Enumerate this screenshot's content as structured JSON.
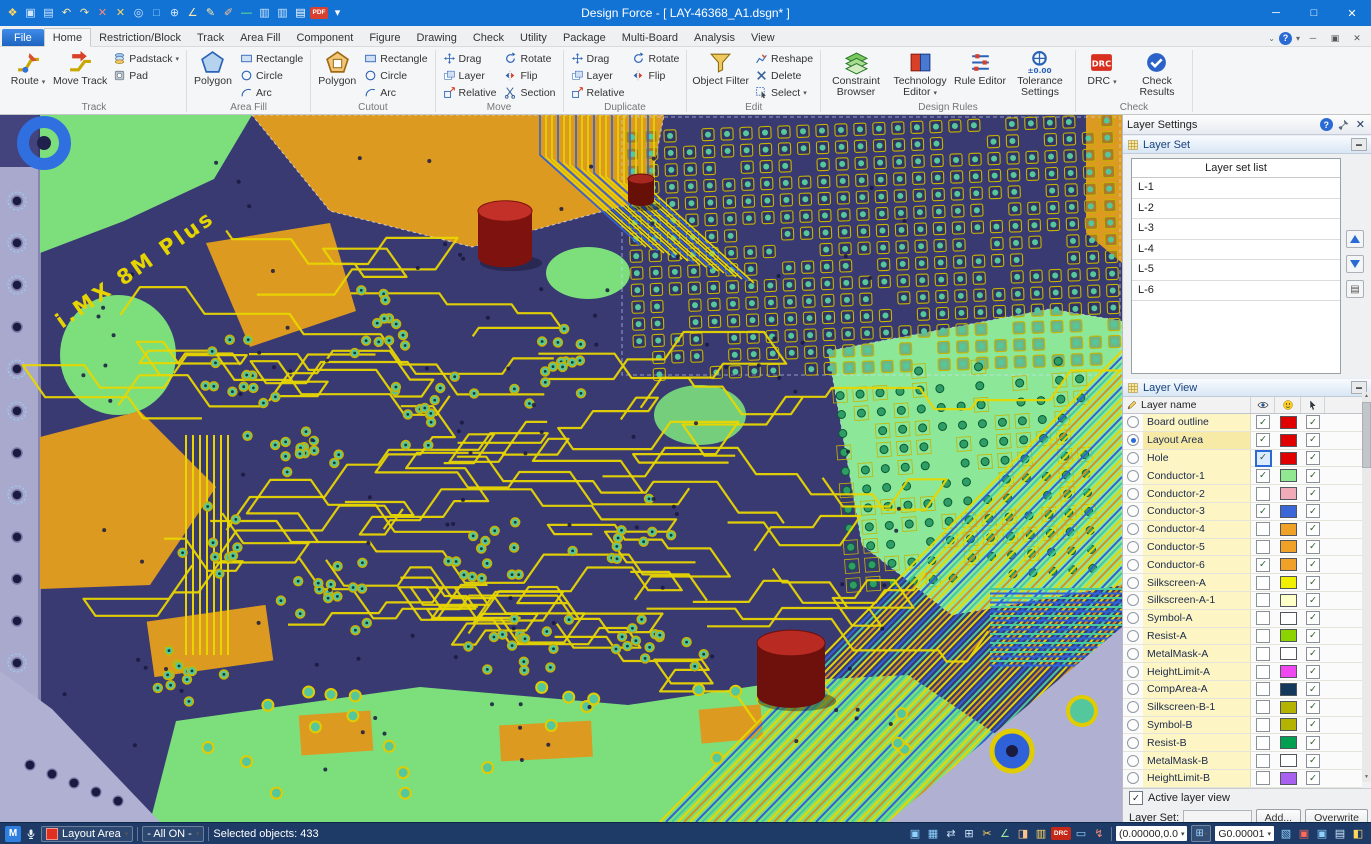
{
  "window": {
    "title": "Design Force - [ LAY-46368_A1.dsgn* ]"
  },
  "qat_icons": [
    {
      "name": "app-logo-icon",
      "glyph": "❖",
      "color": "#ffd65e"
    },
    {
      "name": "save-icon",
      "glyph": "▣",
      "color": "#cfe6ff"
    },
    {
      "name": "print-icon",
      "glyph": "▤",
      "color": "#cfe6ff"
    },
    {
      "name": "undo-icon",
      "glyph": "↶",
      "color": "#ffe9a8"
    },
    {
      "name": "redo-icon",
      "glyph": "↷",
      "color": "#ffe9a8"
    },
    {
      "name": "delete-red-icon",
      "glyph": "✕",
      "color": "#ff8a76"
    },
    {
      "name": "delete-yellow-icon",
      "glyph": "✕",
      "color": "#ffd65e"
    },
    {
      "name": "zoom-window-icon",
      "glyph": "◎",
      "color": "#cfe6ff"
    },
    {
      "name": "select-mode-icon",
      "glyph": "□",
      "color": "#9fd4ff"
    },
    {
      "name": "pan-icon",
      "glyph": "⊕",
      "color": "#cfe6ff"
    },
    {
      "name": "angle-measure-icon",
      "glyph": "∠",
      "color": "#ffe9a8"
    },
    {
      "name": "pencil-icon",
      "glyph": "✎",
      "color": "#ffe9a8"
    },
    {
      "name": "highlight-icon",
      "glyph": "✐",
      "color": "#ffc08a"
    },
    {
      "name": "line-style-icon",
      "glyph": "—",
      "color": "#7aff7a"
    },
    {
      "name": "window-tile-icon",
      "glyph": "▥",
      "color": "#cfe6ff"
    },
    {
      "name": "window-cascade-icon",
      "glyph": "▥",
      "color": "#cfe6ff"
    },
    {
      "name": "report-icon",
      "glyph": "▤",
      "color": "#ffffff"
    },
    {
      "name": "pdf-export-icon",
      "glyph": "PDF",
      "color": "#ffffff"
    },
    {
      "name": "qat-customize-icon",
      "glyph": "▾",
      "color": "#ffffff"
    }
  ],
  "ribbon": {
    "tabs": [
      "File",
      "Home",
      "Restriction/Block",
      "Track",
      "Area Fill",
      "Component",
      "Figure",
      "Drawing",
      "Check",
      "Utility",
      "Package",
      "Multi-Board",
      "Analysis",
      "View"
    ],
    "active_tab": "Home",
    "track": {
      "label": "Track",
      "route": "Route",
      "move_track": "Move Track",
      "padstack": "Padstack",
      "pad": "Pad"
    },
    "area_fill": {
      "label": "Area Fill",
      "polygon": "Polygon",
      "rectangle": "Rectangle",
      "circle": "Circle",
      "arc": "Arc"
    },
    "cutout": {
      "label": "Cutout",
      "polygon": "Polygon",
      "rectangle": "Rectangle",
      "circle": "Circle",
      "arc": "Arc"
    },
    "move": {
      "label": "Move",
      "drag": "Drag",
      "layer": "Layer",
      "relative": "Relative",
      "rotate": "Rotate",
      "flip": "Flip",
      "section": "Section"
    },
    "duplicate": {
      "label": "Duplicate",
      "drag": "Drag",
      "layer": "Layer",
      "relative": "Relative",
      "rotate": "Rotate",
      "flip": "Flip"
    },
    "edit": {
      "label": "Edit",
      "object_filter": "Object Filter",
      "reshape": "Reshape",
      "delete": "Delete",
      "select": "Select"
    },
    "design_rules": {
      "label": "Design Rules",
      "constraint_browser": "Constraint Browser",
      "technology_editor": "Technology Editor",
      "rule_editor": "Rule Editor",
      "tolerance_settings": "Tolerance Settings"
    },
    "check": {
      "label": "Check",
      "drc": "DRC",
      "check_results": "Check Results"
    }
  },
  "panel": {
    "title": "Layer Settings",
    "layer_set": {
      "header": "Layer Set",
      "list_title": "Layer set list",
      "items": [
        "L-1",
        "L-2",
        "L-3",
        "L-4",
        "L-5",
        "L-6"
      ]
    },
    "layer_view": {
      "header": "Layer View",
      "name_column": "Layer name",
      "rows": [
        {
          "name": "Board outline",
          "visible": true,
          "color": "#e00000",
          "select": true
        },
        {
          "name": "Layout Area",
          "visible": true,
          "color": "#e00000",
          "select": true,
          "active": true
        },
        {
          "name": "Hole",
          "visible": true,
          "color": "#e00000",
          "select": true,
          "focused": true
        },
        {
          "name": "Conductor-1",
          "visible": true,
          "color": "#90e890",
          "select": true
        },
        {
          "name": "Conductor-2",
          "visible": false,
          "color": "#f0aab8",
          "select": true
        },
        {
          "name": "Conductor-3",
          "visible": true,
          "color": "#3a66d8",
          "select": true
        },
        {
          "name": "Conductor-4",
          "visible": false,
          "color": "#f0a228",
          "select": true
        },
        {
          "name": "Conductor-5",
          "visible": false,
          "color": "#f0a228",
          "select": true
        },
        {
          "name": "Conductor-6",
          "visible": true,
          "color": "#f0a228",
          "select": true
        },
        {
          "name": "Silkscreen-A",
          "visible": false,
          "color": "#f0f000",
          "select": true
        },
        {
          "name": "Silkscreen-A-1",
          "visible": false,
          "color": "#ffffc8",
          "select": true
        },
        {
          "name": "Symbol-A",
          "visible": false,
          "color": "#ffffff",
          "select": true
        },
        {
          "name": "Resist-A",
          "visible": false,
          "color": "#8cd400",
          "select": true
        },
        {
          "name": "MetalMask-A",
          "visible": false,
          "color": "#ffffff",
          "select": true
        },
        {
          "name": "HeightLimit-A",
          "visible": false,
          "color": "#f048f0",
          "select": true
        },
        {
          "name": "CompArea-A",
          "visible": false,
          "color": "#14395c",
          "select": true
        },
        {
          "name": "Silkscreen-B-1",
          "visible": false,
          "color": "#b4b400",
          "select": true
        },
        {
          "name": "Symbol-B",
          "visible": false,
          "color": "#b4b400",
          "select": true
        },
        {
          "name": "Resist-B",
          "visible": false,
          "color": "#00a050",
          "select": true
        },
        {
          "name": "MetalMask-B",
          "visible": false,
          "color": "#ffffff",
          "select": true
        },
        {
          "name": "HeightLimit-B",
          "visible": false,
          "color": "#a860f0",
          "select": true
        }
      ]
    },
    "active_layer_view_label": "Active layer view",
    "active_layer_view_checked": true,
    "layer_set_label": "Layer Set:",
    "add_button": "Add...",
    "overwrite_button": "Overwrite"
  },
  "statusbar": {
    "mode_badge": "M",
    "active_layer": "Layout Area",
    "visibility_filter": "- All ON -",
    "selection_info": "Selected objects: 433",
    "coordinates": "(0.00000,0.0",
    "grid_value": "G0.00001",
    "icons_a": [
      {
        "name": "display-frame-icon",
        "glyph": "▣",
        "color": "#8fd0ff"
      },
      {
        "name": "display-mode-icon",
        "glyph": "▦",
        "color": "#8fd0ff"
      },
      {
        "name": "board-flip-icon",
        "glyph": "⇄",
        "color": "#cfe6ff"
      },
      {
        "name": "align-grid-icon",
        "glyph": "⊞",
        "color": "#cfe6ff"
      },
      {
        "name": "cut-plane-icon",
        "glyph": "✂",
        "color": "#ffd65e"
      },
      {
        "name": "angle-snap-icon",
        "glyph": "∠",
        "color": "#9fe89f"
      },
      {
        "name": "net-highlight-icon",
        "glyph": "◨",
        "color": "#ffc08a"
      },
      {
        "name": "database-icon",
        "glyph": "▥",
        "color": "#ffd65e"
      },
      {
        "name": "online-drc-icon",
        "glyph": "DRC",
        "color": "#ffffff"
      },
      {
        "name": "monitor-icon",
        "glyph": "▭",
        "color": "#8fd0ff"
      },
      {
        "name": "update-icon",
        "glyph": "↯",
        "color": "#ff8a76"
      }
    ],
    "icons_b": [
      {
        "name": "view-3d-icon",
        "glyph": "▧",
        "color": "#8fd0ff"
      },
      {
        "name": "badge-red-icon",
        "glyph": "▣",
        "color": "#ff6a5a"
      },
      {
        "name": "badge-blue-icon",
        "glyph": "▣",
        "color": "#8fd0ff"
      },
      {
        "name": "log-icon",
        "glyph": "▤",
        "color": "#cfe6ff"
      },
      {
        "name": "half-view-icon",
        "glyph": "◧",
        "color": "#ffd65e"
      }
    ]
  },
  "canvas": {
    "board_text": "i.MX 8M Plus"
  },
  "colors": {
    "titlebar": "#1273d4",
    "statusbar": "#1d3b66",
    "accent": "#2a6ad4",
    "active_layer_swatch": "#e03020"
  }
}
